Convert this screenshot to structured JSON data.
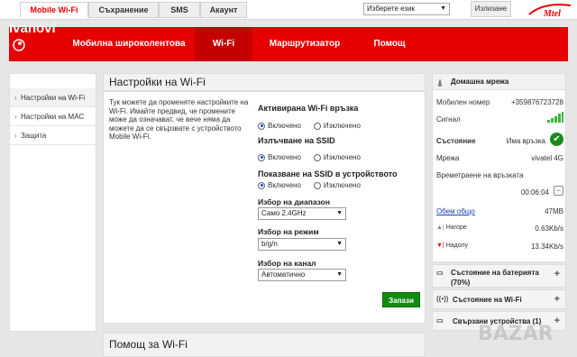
{
  "top_tabs": [
    "Mobile Wi-Fi",
    "Съхранение",
    "SMS",
    "Акаунт"
  ],
  "language_select": "Изберете език",
  "logout": "Излизане",
  "mtel_logo": "Mtel",
  "brand": {
    "line1": "Ivanovi"
  },
  "nav": [
    "Мобилна широколентова",
    "Wi-Fi",
    "Маршрутизатор",
    "Помощ"
  ],
  "sidebar": [
    "Настройки на Wi-Fi",
    "Настройки на MAC",
    "Защита"
  ],
  "panel": {
    "title": "Настройки на Wi-Fi",
    "intro": "Тук можете да променяте настройките на Wi-Fi. Имайте предвид, че промените може да означават, че вече няма да можете да се свързвате с устройството Mobile Wi-Fi.",
    "sections": [
      {
        "label": "Активирана Wi-Fi връзка",
        "on": "Включено",
        "off": "Изключено"
      },
      {
        "label": "Излъчване на SSID",
        "on": "Включено",
        "off": "Изключено"
      },
      {
        "label": "Показване на SSID в устройството",
        "on": "Включено",
        "off": "Изключено"
      }
    ],
    "band_label": "Избор на диапазон",
    "band_value": "Само 2.4GHz",
    "mode_label": "Избор на режим",
    "mode_value": "b/g/n",
    "channel_label": "Избор на канал",
    "channel_value": "Автоматично",
    "save": "Запази"
  },
  "help_title": "Помощ за Wi-Fi",
  "status": {
    "title": "Домашна мрежа",
    "rows": [
      {
        "label": "Мобилен номер",
        "value": "+359876723728"
      },
      {
        "label": "Сигнал",
        "value": ""
      },
      {
        "label": "Състояние",
        "value": "Има връзка"
      },
      {
        "label": "Мрежа",
        "value": "vivatel 4G"
      },
      {
        "label": "Времетраене на връзката",
        "value": ""
      },
      {
        "label": "",
        "value": "00:06:04"
      },
      {
        "label": "Обем общо",
        "value": "47MB"
      },
      {
        "label": "Нагоре",
        "value": "0.63Kb/s"
      },
      {
        "label": "Надолу",
        "value": "13.34Kb/s"
      }
    ]
  },
  "accordions": [
    "Състояние на батерията (70%)",
    "Състояние на Wi-Fi",
    "Свързани устройства (1)"
  ],
  "watermark": "BAZAR"
}
